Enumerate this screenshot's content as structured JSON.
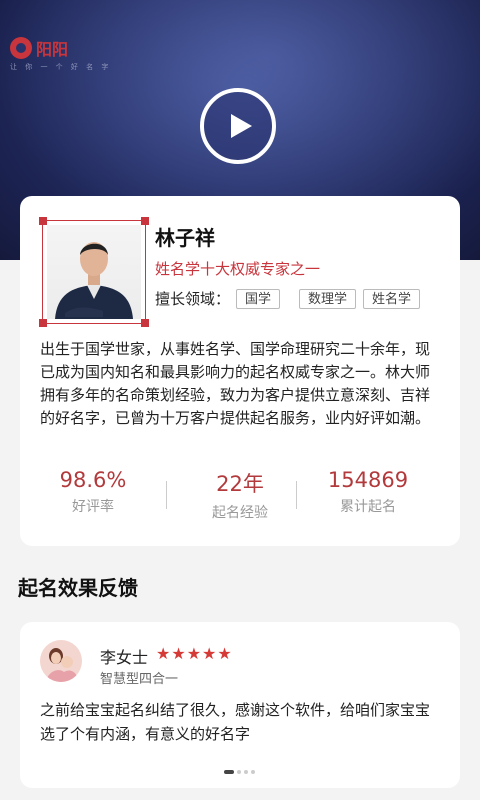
{
  "hero": {
    "logo_text": "阳阳",
    "slogan": "让 你 一 个 好 名 字"
  },
  "expert": {
    "name": "林子祥",
    "subtitle": "姓名学十大权威专家之一",
    "field_label": "擅长领域：",
    "tags": [
      "国学",
      "数理学",
      "姓名学"
    ],
    "bio": "出生于国学世家，从事姓名学、国学命理研究二十余年，现已成为国内知名和最具影响力的起名权威专家之一。林大师拥有多年的名命策划经验，致力为客户提供立意深刻、吉祥的好名字，已曾为十万客户提供起名服务，业内好评如潮。",
    "stats": [
      {
        "value": "98.6%",
        "label": "好评率"
      },
      {
        "value": "22年",
        "label": "起名经验"
      },
      {
        "value": "154869",
        "label": "累计起名"
      }
    ]
  },
  "feedback": {
    "section_title": "起名效果反馈",
    "review": {
      "name": "李女士",
      "rating": 5,
      "subtitle": "智慧型四合一",
      "text": "之前给宝宝起名纠结了很久，感谢这个软件，给咱们家宝宝选了个有内涵，有意义的好名字"
    },
    "carousel": {
      "count": 4,
      "active": 0
    }
  },
  "colors": {
    "accent": "#c8353c",
    "stat": "#b23a3c",
    "hero_bg": "#28336b",
    "star": "#d63a37"
  }
}
